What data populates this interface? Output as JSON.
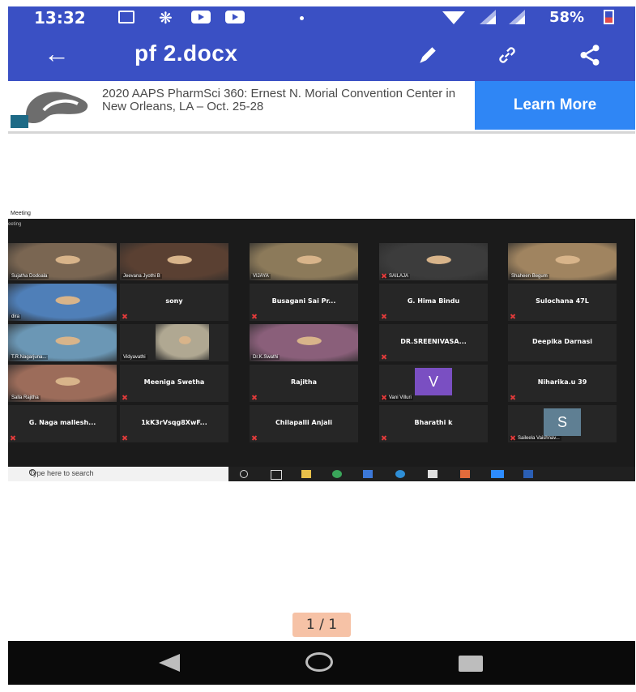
{
  "status_bar": {
    "time": "13:32",
    "battery": "58%"
  },
  "app_bar": {
    "title": "pf 2.docx",
    "back": "←"
  },
  "ad": {
    "text": "2020 AAPS PharmSci 360: Ernest N. Morial Convention Center in New Orleans, LA – Oct. 25-28",
    "cta": "Learn More"
  },
  "meeting": {
    "caption1": "Meeting",
    "caption2": "eeting",
    "tiles": [
      {
        "label": "Sujatha Dodoala",
        "type": "video",
        "bg": "#7a6652"
      },
      {
        "label": "Jeevana Jyothi B",
        "type": "video",
        "bg": "#5a4032"
      },
      {
        "label": "VIJAYA",
        "type": "video",
        "bg": "#8c7a5a"
      },
      {
        "label": "SAILAJA",
        "type": "video",
        "bg": "#3c3c3c",
        "muted": true
      },
      {
        "label": "Shaheen Begum",
        "type": "video",
        "bg": "#a08460"
      },
      {
        "label": "dira",
        "type": "video",
        "bg": "#4f7fb8"
      },
      {
        "name": "sony",
        "type": "name",
        "muted": true
      },
      {
        "name": "Busagani Sai Pr...",
        "type": "name",
        "muted": true
      },
      {
        "name": "G. Hima Bindu",
        "type": "name",
        "muted": true
      },
      {
        "name": "Sulochana 47L",
        "type": "name",
        "muted": true
      },
      {
        "label": "T.R.Nagarjuna...",
        "type": "video",
        "bg": "#6b97b5",
        "active": true
      },
      {
        "label": "Vidyavathi",
        "type": "video-small",
        "bg": "#b0a892"
      },
      {
        "label": "Dr.K.Swathi",
        "type": "video",
        "bg": "#8a5f7a"
      },
      {
        "name": "DR.SREENIVASA...",
        "type": "name",
        "muted": true
      },
      {
        "name": "Deepika Darnasi",
        "type": "name"
      },
      {
        "label": "Salla Rajitha",
        "type": "video",
        "bg": "#9c6c5a"
      },
      {
        "name": "Meeniga Swetha",
        "type": "name",
        "muted": true
      },
      {
        "name": "Rajitha",
        "type": "name",
        "muted": true
      },
      {
        "label": "Vani Villuri",
        "type": "avatar",
        "letter": "V",
        "color": "#7a4fc2",
        "muted": true
      },
      {
        "name": "Niharika.u 39",
        "type": "name",
        "muted": true
      },
      {
        "name": "G. Naga mallesh...",
        "type": "name",
        "muted": true
      },
      {
        "name": "1kK3rVsqg8XwF...",
        "type": "name",
        "muted": true
      },
      {
        "name": "Chilapalli Anjali",
        "type": "name",
        "muted": true
      },
      {
        "name": "Bharathi k",
        "type": "name",
        "muted": true
      },
      {
        "label": "Saileela Vaishnav...",
        "type": "avatar",
        "letter": "S",
        "color": "#5f7f93",
        "muted": true
      }
    ],
    "taskbar": {
      "search_placeholder": "Type here to search"
    }
  },
  "pager": {
    "text": "1 / 1"
  },
  "colors": {
    "primary": "#3a50c4",
    "cta": "#2f86f5",
    "pager": "#f6c2a6"
  }
}
